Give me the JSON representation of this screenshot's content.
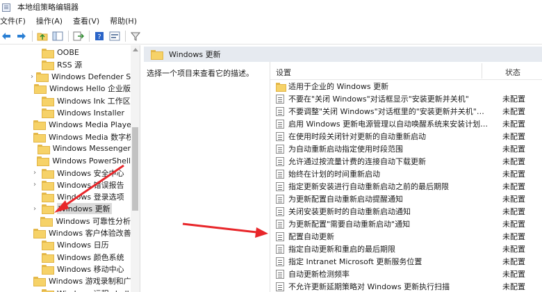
{
  "window": {
    "title": "本地组策略编辑器"
  },
  "menu": [
    "文件(F)",
    "操作(A)",
    "查看(V)",
    "帮助(H)"
  ],
  "toolbar": {
    "icons": [
      "back-arrow-icon",
      "forward-arrow-icon",
      "up-folder-icon",
      "show-hide-tree-icon",
      "export-list-icon",
      "help-icon",
      "properties-icon",
      "filter-icon"
    ]
  },
  "tree": {
    "items": [
      {
        "label": "OOBE",
        "expandable": false,
        "selected": false
      },
      {
        "label": "RSS 源",
        "expandable": false,
        "selected": false
      },
      {
        "label": "Windows Defender Sr",
        "expandable": true,
        "selected": false
      },
      {
        "label": "Windows Hello 企业版",
        "expandable": false,
        "selected": false
      },
      {
        "label": "Windows Ink 工作区",
        "expandable": false,
        "selected": false
      },
      {
        "label": "Windows Installer",
        "expandable": false,
        "selected": false
      },
      {
        "label": "Windows Media Playe",
        "expandable": false,
        "selected": false
      },
      {
        "label": "Windows Media 数字权",
        "expandable": false,
        "selected": false
      },
      {
        "label": "Windows Messenger",
        "expandable": false,
        "selected": false
      },
      {
        "label": "Windows PowerShell",
        "expandable": false,
        "selected": false
      },
      {
        "label": "Windows 安全中心",
        "expandable": true,
        "selected": false
      },
      {
        "label": "Windows 错误报告",
        "expandable": true,
        "selected": false
      },
      {
        "label": "Windows 登录选项",
        "expandable": false,
        "selected": false
      },
      {
        "label": "Windows 更新",
        "expandable": true,
        "selected": true
      },
      {
        "label": "Windows 可靠性分析",
        "expandable": false,
        "selected": false
      },
      {
        "label": "Windows 客户体验改善",
        "expandable": false,
        "selected": false
      },
      {
        "label": "Windows 日历",
        "expandable": false,
        "selected": false
      },
      {
        "label": "Windows 颜色系统",
        "expandable": false,
        "selected": false
      },
      {
        "label": "Windows 移动中心",
        "expandable": false,
        "selected": false
      },
      {
        "label": "Windows 游戏录制和广",
        "expandable": false,
        "selected": false
      },
      {
        "label": "Windows 远程 shell",
        "expandable": false,
        "selected": false
      }
    ]
  },
  "details": {
    "header": "Windows 更新",
    "description": "选择一个项目来查看它的描述。",
    "columns": {
      "setting": "设置",
      "state": "状态"
    },
    "rows": [
      {
        "name": "适用于企业的 Windows 更新",
        "state": "",
        "kind": "folder"
      },
      {
        "name": "不要在\"关闭 Windows\"对话框显示\"安装更新并关机\"",
        "state": "未配置",
        "kind": "policy"
      },
      {
        "name": "不要调整\"关闭 Windows\"对话框里的\"安装更新并关机\"的默...",
        "state": "未配置",
        "kind": "policy"
      },
      {
        "name": "启用 Windows 更新电源管理以自动唤醒系统来安装计划的...",
        "state": "未配置",
        "kind": "policy"
      },
      {
        "name": "在使用时段关闭针对更新的自动重新启动",
        "state": "未配置",
        "kind": "policy"
      },
      {
        "name": "为自动重新启动指定使用时段范围",
        "state": "未配置",
        "kind": "policy"
      },
      {
        "name": "允许通过按流量计费的连接自动下载更新",
        "state": "未配置",
        "kind": "policy"
      },
      {
        "name": "始终在计划的时间重新启动",
        "state": "未配置",
        "kind": "policy"
      },
      {
        "name": "指定更新安装进行自动重新启动之前的最后期限",
        "state": "未配置",
        "kind": "policy"
      },
      {
        "name": "为更新配置自动重新启动提醒通知",
        "state": "未配置",
        "kind": "policy"
      },
      {
        "name": "关闭安装更新时的自动重新启动通知",
        "state": "未配置",
        "kind": "policy"
      },
      {
        "name": "为更新配置\"需要自动重新启动\"通知",
        "state": "未配置",
        "kind": "policy"
      },
      {
        "name": "配置自动更新",
        "state": "未配置",
        "kind": "policy"
      },
      {
        "name": "指定自动更新和重启的最后期限",
        "state": "未配置",
        "kind": "policy"
      },
      {
        "name": "指定 Intranet Microsoft 更新服务位置",
        "state": "未配置",
        "kind": "policy"
      },
      {
        "name": "自动更新检测频率",
        "state": "未配置",
        "kind": "policy"
      },
      {
        "name": "不允许更新延期策略对 Windows 更新执行扫描",
        "state": "未配置",
        "kind": "policy"
      }
    ]
  },
  "colors": {
    "accent": "#e8262a",
    "header_bg": "#e6eaf0",
    "folder": "#f6d268"
  }
}
